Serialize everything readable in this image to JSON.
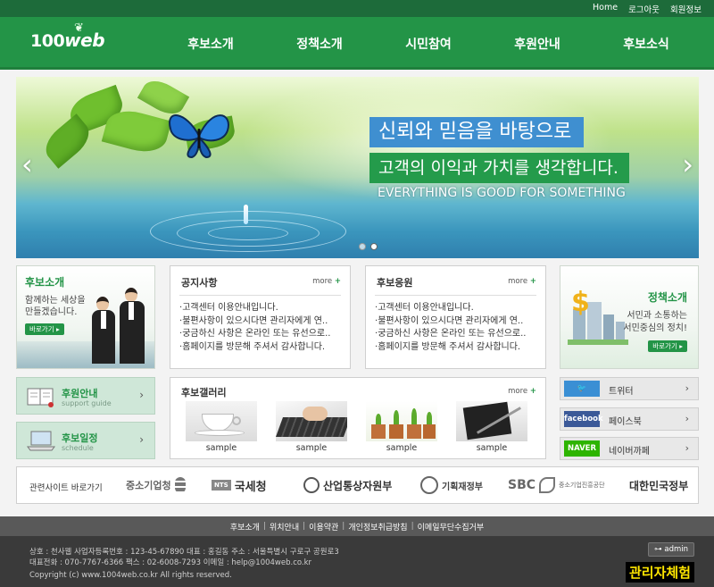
{
  "top_links": [
    "Home",
    "로그아웃",
    "회원정보"
  ],
  "logo": {
    "number": "100",
    "web": "web"
  },
  "nav": [
    "후보소개",
    "정책소개",
    "시민참여",
    "후원안내",
    "후보소식"
  ],
  "banner": {
    "slogan1": "신뢰와 믿음을 바탕으로",
    "slogan2": "고객의 이익과 가치를 생각합니다.",
    "slogan3": "EVERYTHING IS GOOD FOR SOMETHING",
    "prev": "‹",
    "next": "›"
  },
  "candidate_promo": {
    "title": "후보소개",
    "subtitle": "함께하는 세상을 만들겠습니다.",
    "button": "바로가기 ▸"
  },
  "notice": {
    "title": "공지사항",
    "more": "more",
    "items": [
      "고객센터 이용안내입니다.",
      "불편사항이 있으시다면 관리자에게 연..",
      "궁금하신 사항은 온라인 또는 유선으로..",
      "홈페이지를 방문해 주셔서 감사합니다."
    ]
  },
  "support_board": {
    "title": "후보응원",
    "more": "more",
    "items": [
      "고객센터 이용안내입니다.",
      "불편사항이 있으시다면 관리자에게 연..",
      "궁금하신 사항은 온라인 또는 유선으로..",
      "홈페이지를 방문해 주셔서 감사합니다."
    ]
  },
  "policy_promo": {
    "title": "정책소개",
    "line1": "서민과 소통하는",
    "line2": "서민중심의 정치!",
    "button": "바로가기 ▸"
  },
  "side_buttons": [
    {
      "title": "후원안내",
      "subtitle": "support guide"
    },
    {
      "title": "후보일정",
      "subtitle": "schedule"
    }
  ],
  "gallery": {
    "title": "후보갤러리",
    "more": "more",
    "captions": [
      "sample",
      "sample",
      "sample",
      "sample"
    ]
  },
  "social": [
    {
      "icon": "twitter-icon",
      "badge": "🐦",
      "label": "트위터",
      "color": "#3a8fd4"
    },
    {
      "icon": "facebook-icon",
      "badge": "facebook",
      "label": "페이스북",
      "color": "#3b5998"
    },
    {
      "icon": "naver-icon",
      "badge": "NAVER",
      "label": "네이버까페",
      "color": "#2db400"
    }
  ],
  "related": {
    "title": "관련사이트 바로가기",
    "sites": [
      "중소기업청",
      "국세청",
      "산업통상자원부",
      "기획재정부",
      "SBC",
      "대한민국정부"
    ],
    "nts_badge": "NTS",
    "sbc_sub": "중소기업진흥공단"
  },
  "footer_links": [
    "후보소개",
    "위치안내",
    "이용약관",
    "개인정보취급방침",
    "이메일무단수집거부"
  ],
  "footer": {
    "line1": "상호 : 천사웹  사업자등록번호 : 123-45-67890  대표 : 홍길동  주소 : 서울특별시 구로구 공원로3",
    "line2": "대표전화 : 070-7767-6366  팩스 : 02-6008-7293  이메일 : help@1004web.co.kr",
    "line3": "Copyright (c) www.1004web.co.kr All rights reserved.",
    "admin": "⊶ admin",
    "admin_experience": "관리자체험"
  },
  "colors": {
    "brand_green": "#239447",
    "dark_green": "#1d6b3a",
    "banner_blue": "#3f8fd0"
  }
}
